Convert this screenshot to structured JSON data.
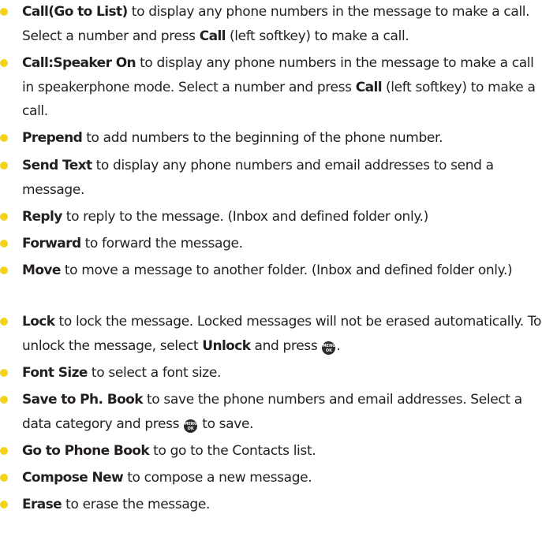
{
  "colors": {
    "bullet": "#f5d21a",
    "text": "#231f20",
    "key_bg": "#2b2b2b"
  },
  "menu_key": {
    "icon": "menu-ok-key-icon",
    "line1": "MENU",
    "line2": "OK"
  },
  "items": [
    {
      "term": "Call(Go to List)",
      "pre": " to display any phone numbers in the message to make a call. Select a number and press ",
      "term2": "Call",
      "post": " (left softkey) to make a call."
    },
    {
      "term": "Call:Speaker On",
      "pre": " to display any phone numbers in the message to make a call in speakerphone mode. Select a number and press ",
      "term2": "Call",
      "post": " (left softkey) to make a call."
    },
    {
      "term": "Prepend",
      "pre": " to add numbers to the beginning of the phone number."
    },
    {
      "term": "Send Text",
      "pre": " to display any phone numbers and email addresses to send a message."
    },
    {
      "term": "Reply",
      "pre": " to reply to the message. (Inbox and defined folder only.)"
    },
    {
      "term": "Forward",
      "pre": " to forward the message."
    },
    {
      "term": "Move",
      "pre": " to move a message to another folder. (Inbox and defined folder only.)"
    },
    {
      "term": "Lock",
      "pre": " to lock the message. Locked messages will not be erased automatically. To unlock the message, select ",
      "term2": "Unlock",
      "post": " and press ",
      "post2": "."
    },
    {
      "term": "Font Size",
      "pre": " to select a font size."
    },
    {
      "term": "Save to Ph. Book",
      "pre": " to save the phone numbers and email addresses. Select a data category and press ",
      "post2": " to save."
    },
    {
      "term": "Go to Phone Book",
      "pre": " to go to the Contacts list."
    },
    {
      "term": "Compose New",
      "pre": " to compose a new message."
    },
    {
      "term": "Erase",
      "pre": " to erase the message."
    }
  ]
}
